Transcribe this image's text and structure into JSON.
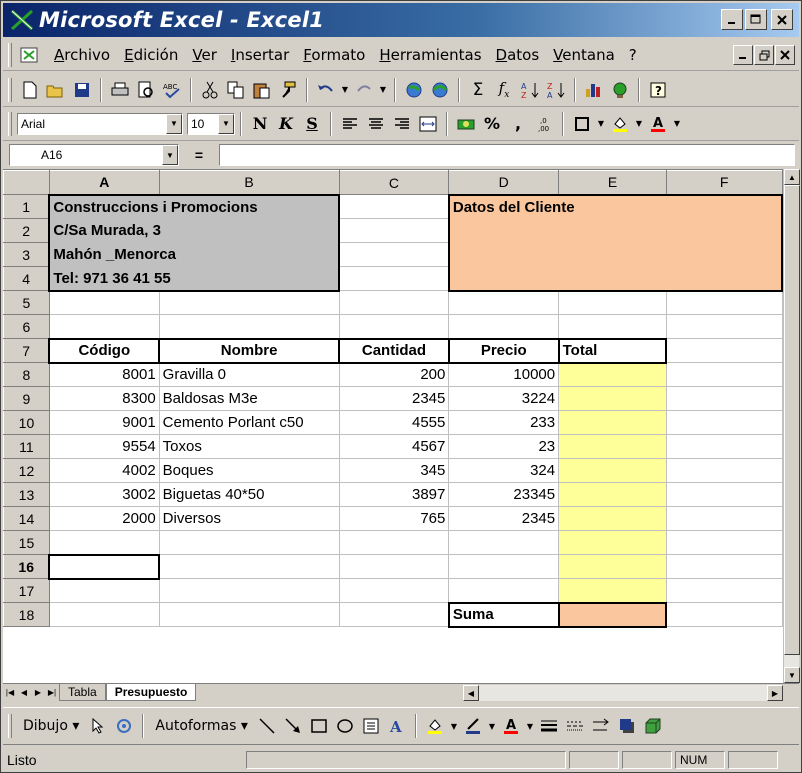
{
  "window": {
    "title": "Microsoft Excel - Excel1"
  },
  "menu": [
    "Archivo",
    "Edición",
    "Ver",
    "Insertar",
    "Formato",
    "Herramientas",
    "Datos",
    "Ventana",
    "?"
  ],
  "format_toolbar": {
    "font": "Arial",
    "size": "10"
  },
  "formula_bar": {
    "name_box": "A16",
    "equals": "=",
    "content": ""
  },
  "columns": [
    "A",
    "B",
    "C",
    "D",
    "E",
    "F"
  ],
  "rows": [
    "1",
    "2",
    "3",
    "4",
    "5",
    "6",
    "7",
    "8",
    "9",
    "10",
    "11",
    "12",
    "13",
    "14",
    "15",
    "16",
    "17",
    "18"
  ],
  "header_block": {
    "line1": "Construccions i Promocions",
    "line2": "C/Sa Murada, 3",
    "line3": "Mahón _Menorca",
    "line4": "Tel: 971 36 41 55"
  },
  "client_block": {
    "title": "Datos del Cliente"
  },
  "table": {
    "headers": {
      "codigo": "Código",
      "nombre": "Nombre",
      "cantidad": "Cantidad",
      "precio": "Precio",
      "total": "Total"
    },
    "rows": [
      {
        "codigo": "8001",
        "nombre": "Gravilla 0",
        "cantidad": "200",
        "precio": "10000"
      },
      {
        "codigo": "8300",
        "nombre": "Baldosas M3e",
        "cantidad": "2345",
        "precio": "3224"
      },
      {
        "codigo": "9001",
        "nombre": "Cemento Porlant c50",
        "cantidad": "4555",
        "precio": "233"
      },
      {
        "codigo": "9554",
        "nombre": "Toxos",
        "cantidad": "4567",
        "precio": "23"
      },
      {
        "codigo": "4002",
        "nombre": "Boques",
        "cantidad": "345",
        "precio": "324"
      },
      {
        "codigo": "3002",
        "nombre": "Biguetas 40*50",
        "cantidad": "3897",
        "precio": "23345"
      },
      {
        "codigo": "2000",
        "nombre": "Diversos",
        "cantidad": "765",
        "precio": "2345"
      }
    ],
    "suma_label": "Suma"
  },
  "sheet_tabs": {
    "tab1": "Tabla",
    "tab2": "Presupuesto"
  },
  "drawing_toolbar": {
    "dibujo": "Dibujo",
    "autoformas": "Autoformas"
  },
  "status": {
    "text": "Listo",
    "num": "NUM"
  },
  "colors": {
    "grey_fill": "#c0c0c0",
    "peach_fill": "#f9c69d",
    "yellow_fill": "#ffff99",
    "title_blue": "#0a246a"
  },
  "icons": [
    "excel-app-icon",
    "new-doc-icon",
    "open-icon",
    "save-icon",
    "print-icon",
    "print-preview-icon",
    "spelling-icon",
    "cut-icon",
    "copy-icon",
    "paste-icon",
    "format-painter-icon",
    "undo-icon",
    "redo-icon",
    "insert-hyperlink-icon",
    "web-icon",
    "autosum-icon",
    "function-icon",
    "sort-asc-icon",
    "sort-desc-icon",
    "chart-wizard-icon",
    "map-icon",
    "help-icon",
    "bold-icon",
    "italic-icon",
    "underline-icon",
    "align-left-icon",
    "align-center-icon",
    "align-right-icon",
    "merge-center-icon",
    "currency-icon",
    "percent-icon",
    "comma-icon",
    "increase-decimal-icon",
    "borders-icon",
    "fill-color-icon",
    "font-color-icon"
  ]
}
